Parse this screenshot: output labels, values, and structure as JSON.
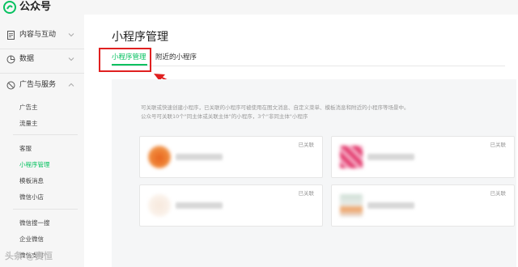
{
  "app": {
    "title": "公众号"
  },
  "sidebar": {
    "groups": [
      {
        "label": "内容与互动",
        "icon": "document-icon"
      },
      {
        "label": "数据",
        "icon": "pie-chart-icon"
      },
      {
        "label": "广告与服务",
        "icon": "slash-circle-icon"
      }
    ],
    "ad_items": [
      "广告主",
      "流量主"
    ],
    "service_items": [
      "客服",
      "小程序管理",
      "模板消息",
      "微信小店"
    ],
    "other_items": [
      "微信搜一搜",
      "企业微信",
      "微信支付"
    ]
  },
  "main": {
    "title": "小程序管理",
    "tabs": [
      {
        "label": "小程序管理",
        "active": true
      },
      {
        "label": "附近的小程序",
        "active": false
      }
    ],
    "description": [
      "可关联或快速创建小程序，已关联的小程序可被使用在图文消息、自定义菜单、模板消息和附近的小程序等场景中。",
      "公众号可关联10个\"同主体或关联主体\"的小程序，3个\"非同主体\"小程序"
    ],
    "cards": [
      {
        "status": "已关联"
      },
      {
        "status": "已关联"
      },
      {
        "status": "已关联"
      },
      {
        "status": "已关联"
      }
    ]
  },
  "watermark": "头条 @赛恒",
  "colors": {
    "accent": "#07c160",
    "annotation": "#e02020"
  }
}
